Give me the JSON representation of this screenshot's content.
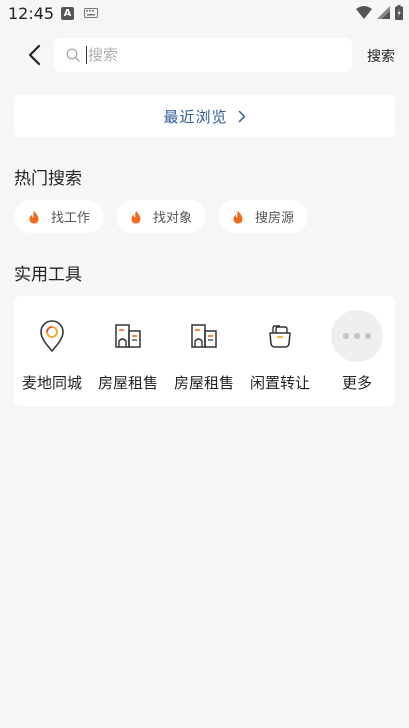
{
  "status_bar": {
    "time": "12:45",
    "notification_letter": "A"
  },
  "header": {
    "search_placeholder": "搜索",
    "search_button": "搜索"
  },
  "recent": {
    "label": "最近浏览"
  },
  "hot_search": {
    "title": "热门搜索",
    "chips": [
      {
        "label": "找工作",
        "icon": "flame-icon"
      },
      {
        "label": "找对象",
        "icon": "flame-icon"
      },
      {
        "label": "搜房源",
        "icon": "flame-icon"
      }
    ]
  },
  "tools": {
    "title": "实用工具",
    "items": [
      {
        "label": "麦地同城",
        "icon": "location-pin-icon"
      },
      {
        "label": "房屋租售",
        "icon": "building-icon"
      },
      {
        "label": "房屋租售",
        "icon": "building-icon"
      },
      {
        "label": "闲置转让",
        "icon": "bag-icon"
      },
      {
        "label": "更多",
        "icon": "more-dots-icon"
      }
    ]
  },
  "colors": {
    "accent_blue": "#2f5a9b",
    "flame_orange": "#f26b1d",
    "background": "#f6f6f6"
  }
}
